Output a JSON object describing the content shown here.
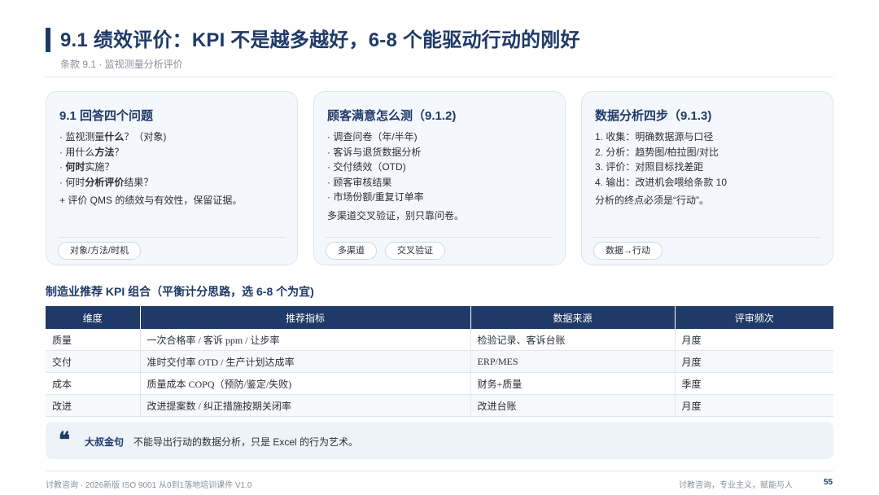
{
  "header": {
    "title": "9.1 绩效评价：KPI 不是越多越好，6-8 个能驱动行动的刚好",
    "subtitle": "条款 9.1 · 监视测量分析评价"
  },
  "cards": [
    {
      "title": "9.1 回答四个问题",
      "items": [
        {
          "pre": "· 监视测量",
          "bold": "什么",
          "post": "？（对象)"
        },
        {
          "pre": "· 用什么",
          "bold": "方法",
          "post": "？"
        },
        {
          "pre": "· ",
          "bold": "何时",
          "post": "实施？"
        },
        {
          "pre": "· 何时",
          "bold": "分析评价",
          "post": "结果？"
        }
      ],
      "extra": "+ 评价 QMS 的绩效与有效性，保留证据。",
      "tags": [
        "对象/方法/时机"
      ]
    },
    {
      "title": "顾客满意怎么测（9.1.2)",
      "items": [
        "· 调查问卷（年/半年)",
        "· 客诉与退货数据分析",
        "· 交付绩效（OTD)",
        "· 顾客审核结果",
        "· 市场份额/重复订单率"
      ],
      "extra": "多渠道交叉验证，别只靠问卷。",
      "tags": [
        "多渠道",
        "交叉验证"
      ]
    },
    {
      "title": "数据分析四步（9.1.3)",
      "items": [
        "1. 收集：明确数据源与口径",
        "2. 分析：趋势图/柏拉图/对比",
        "3. 评价：对照目标找差距",
        "4. 输出：改进机会喂给条款 10"
      ],
      "extra": "分析的终点必须是“行动”。",
      "tags": [
        "数据→行动"
      ]
    }
  ],
  "kpi_section": {
    "title": "制造业推荐 KPI 组合（平衡计分思路，选 6-8 个为宜)",
    "headers": [
      "维度",
      "推荐指标",
      "数据来源",
      "评审频次"
    ],
    "rows": [
      [
        "质量",
        "一次合格率 / 客诉 ppm / 让步率",
        "检验记录、客诉台账",
        "月度"
      ],
      [
        "交付",
        "准时交付率 OTD / 生产计划达成率",
        "ERP/MES",
        "月度"
      ],
      [
        "成本",
        "质量成本 COPQ（预防/鉴定/失败)",
        "财务+质量",
        "季度"
      ],
      [
        "改进",
        "改进提案数 / 纠正措施按期关闭率",
        "改进台账",
        "月度"
      ]
    ]
  },
  "quote": {
    "icon": "quote-icon",
    "mark": "❝",
    "label": "大叔金句",
    "text": "不能导出行动的数据分析，只是 Excel 的行为艺术。"
  },
  "footer": {
    "left": "讨教咨询 · 2026新版 ISO 9001 从0到1落地培训课件 V1.0",
    "right": "讨教咨询，专业主义，赋能与人",
    "page": "55"
  },
  "colors": {
    "accent": "#1f3a68",
    "card_bg": "#f4f7fb",
    "quote_bg": "#eef3f9"
  }
}
